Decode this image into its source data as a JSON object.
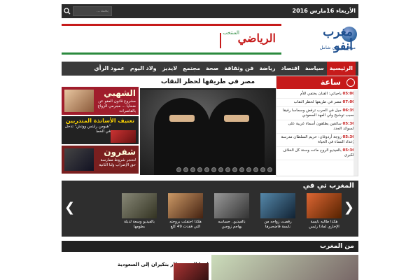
{
  "topbar": {
    "date": "الأربعاء 16مارس 2016",
    "search_placeholder": "بحث..."
  },
  "logo": {
    "mark": "مغرب أنفو",
    "subtitle": "موقع إخباري شامل"
  },
  "banner": {
    "brand": "الرياضي",
    "brand_sub": "المنتخب"
  },
  "nav": {
    "items": [
      "الرئيسية",
      "سياسة",
      "اقتصاد",
      "رياضة",
      "فن وثقافة",
      "صحة",
      "مجتمع",
      "لايديز",
      "ولاد اليوم",
      "عمود الرأي"
    ]
  },
  "left_boxes": [
    {
      "title": "الشهبي",
      "desc": "مشروع قانون العفو عن ضحايا ... مجرمي الزواج بالقاصرات"
    },
    {
      "title": "تعنيف الأساتذة المتدربين",
      "desc": "\"هيومن رايتس ووتش\" تدخل في الخط"
    },
    {
      "title": "شفرون",
      "desc": "لتحجر شروط ممارسة حق الإضراب ولنا الثانية"
    }
  ],
  "main_story": {
    "title": "مصر في طريقها لحظر النقاب",
    "slide_count": 14
  },
  "hour_box": {
    "title": "ساعة",
    "items": [
      {
        "time": "05:00",
        "text": "ياحياتي: الفنان يختفي للأم"
      },
      {
        "time": "07:00",
        "text": "مصر في طريقها لحظر النقاب"
      },
      {
        "time": "06:39",
        "text": "جيل في الحرب ترفض وسماسا رفيقا يسبب توشيح ولي العهد السعودي"
      },
      {
        "time": "05:36",
        "text": "سائقين يطلقون أسماء غريبة على السوائد الجدد"
      },
      {
        "time": "05:36",
        "text": "زوجة أردوغان: حريم السلطان مدرسة لإعداد النساء في الحياة"
      },
      {
        "time": "05:36",
        "text": "بالفيديو الروح ماتت وسنة كل الخلاف الكبرى"
      }
    ]
  },
  "tv": {
    "title": "المغرب تي في",
    "items": [
      {
        "caption": "بالفيديو وسعة لدبلة بطومها"
      },
      {
        "caption": "هكذا احتفلت بروحته التي فقدت 49 كلغ"
      },
      {
        "caption": "بالفيديو.. حساسه يهاجم زوجين"
      },
      {
        "caption": "رقصت زواحه من نايسة قاضحيرها"
      },
      {
        "caption": "هكذا طالبه نايسة الإخاري لماذا رئيس"
      }
    ]
  },
  "section": {
    "title": "من المغرب",
    "headline": "لهذا السبب طار بنكيران إلى السعودية"
  },
  "colors": {
    "accent": "#c61b1b",
    "dark": "#2e2e2e",
    "nav": "#3a3a3a",
    "brand_blue": "#1e4f8f",
    "brand_green": "#2b8a3e"
  }
}
